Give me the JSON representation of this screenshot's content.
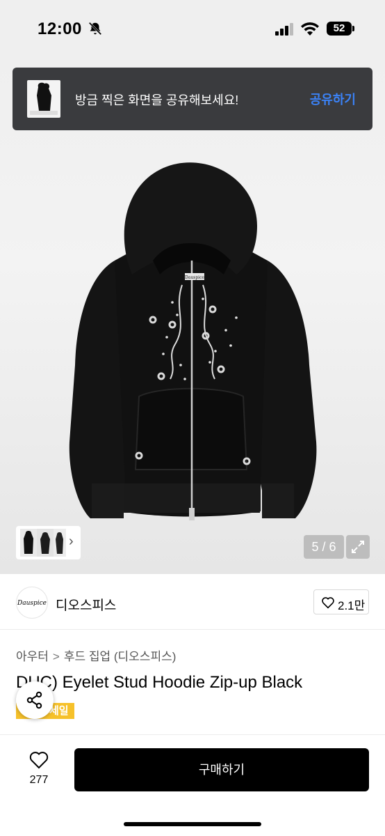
{
  "status_bar": {
    "time": "12:00",
    "battery": "52"
  },
  "share_banner": {
    "text": "방금 찍은 화면을 공유해보세요!",
    "action": "공유하기"
  },
  "gallery": {
    "counter": "5 / 6",
    "hoodie_label": "Dauspice"
  },
  "brand": {
    "logo_text": "Dauspice",
    "name": "디오스피스",
    "likes": "2.1만"
  },
  "breadcrumb": {
    "items": [
      "아우터",
      "후드 집업 (디오스피스)"
    ],
    "separator": ">"
  },
  "product": {
    "title": "DUC) Eyelet Stud Hoodie Zip-up Black",
    "badge": "세일"
  },
  "bottom_bar": {
    "wish_count": "277",
    "buy_label": "구매하기"
  },
  "colors": {
    "accent": "#3b82f6",
    "banner_bg": "#3a3b3e",
    "badge": "#f6c12a",
    "buy_button": "#000000"
  },
  "icons": [
    "bell-slash-icon",
    "signal-icon",
    "wifi-icon",
    "battery-icon",
    "chevron-right-icon",
    "expand-icon",
    "heart-icon",
    "share-icon"
  ]
}
